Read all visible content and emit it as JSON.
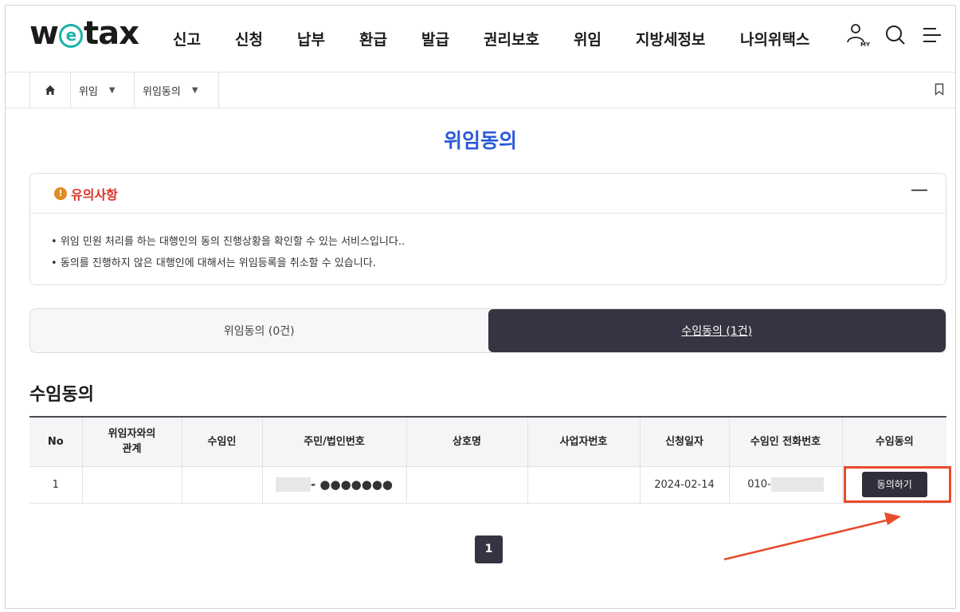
{
  "header": {
    "logo": {
      "pre": "w",
      "mid": "e",
      "post": "tax"
    },
    "nav": [
      "신고",
      "신청",
      "납부",
      "환급",
      "발급",
      "권리보호",
      "위임",
      "지방세정보",
      "나의위택스"
    ],
    "my_label": "MY"
  },
  "breadcrumb": {
    "items": [
      "위임",
      "위임동의"
    ]
  },
  "page_title": "위임동의",
  "notice": {
    "title": "유의사항",
    "collapse_symbol": "—",
    "lines": [
      "• 위임 민원 처리를 하는 대행인의 동의 진행상황을 확인할 수 있는 서비스입니다..",
      "• 동의를 진행하지 않은 대행인에 대해서는 위임등록을 취소할 수 있습니다."
    ]
  },
  "tabs": [
    {
      "label": "위임동의 (0건)",
      "active": false
    },
    {
      "label": "수임동의 (1건)",
      "active": true
    }
  ],
  "section_title": "수임동의",
  "table": {
    "headers": [
      "No",
      "위임자와의 관계",
      "수임인",
      "주민/법인번호",
      "상호명",
      "사업자번호",
      "신청일자",
      "수임인 전화번호",
      "수임동의"
    ],
    "rows": [
      {
        "no": "1",
        "relation": "",
        "delegate": "",
        "id_number_suffix": "- ●●●●●●●",
        "company": "",
        "biz_number": "",
        "date": "2024-02-14",
        "phone_prefix": "010-",
        "action": "동의하기"
      }
    ]
  },
  "pagination": {
    "current": "1"
  },
  "colors": {
    "accent": "#2a5bd7",
    "dark": "#343442",
    "warning": "#d9332a",
    "highlight": "#e84c2b",
    "logo_e": "#19b3a6"
  }
}
